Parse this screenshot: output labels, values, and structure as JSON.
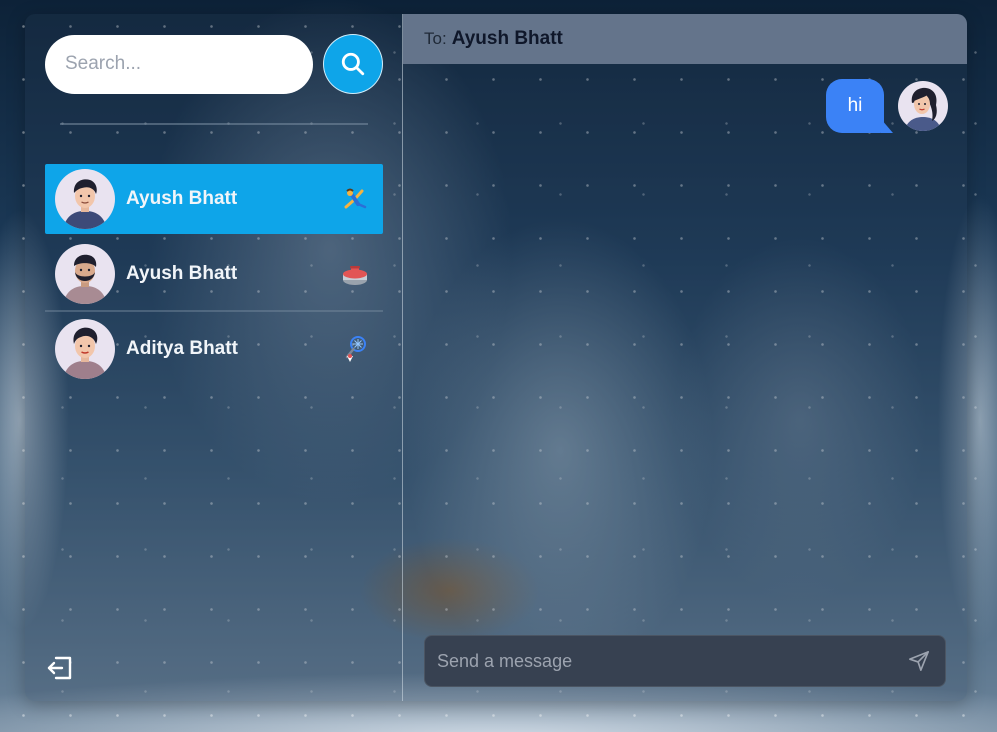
{
  "search": {
    "placeholder": "Search...",
    "button_icon": "search-icon"
  },
  "contacts": [
    {
      "name": "Ayush Bhatt",
      "active": true,
      "emoji_icon": "cartwheel-person-icon"
    },
    {
      "name": "Ayush Bhatt",
      "active": false,
      "emoji_icon": "curling-stone-icon"
    },
    {
      "name": "Aditya Bhatt",
      "active": false,
      "emoji_icon": "badminton-icon"
    }
  ],
  "chat": {
    "to_label": "To:",
    "to_name": "Ayush Bhatt",
    "messages": [
      {
        "text": "hi",
        "from_me": true
      }
    ],
    "composer_placeholder": "Send a message"
  },
  "colors": {
    "accent": "#0ea5e9",
    "bubble": "#3b82f6",
    "header": "#64748b",
    "composer": "#374151"
  },
  "icons": {
    "logout": "logout-icon",
    "send": "send-icon"
  }
}
